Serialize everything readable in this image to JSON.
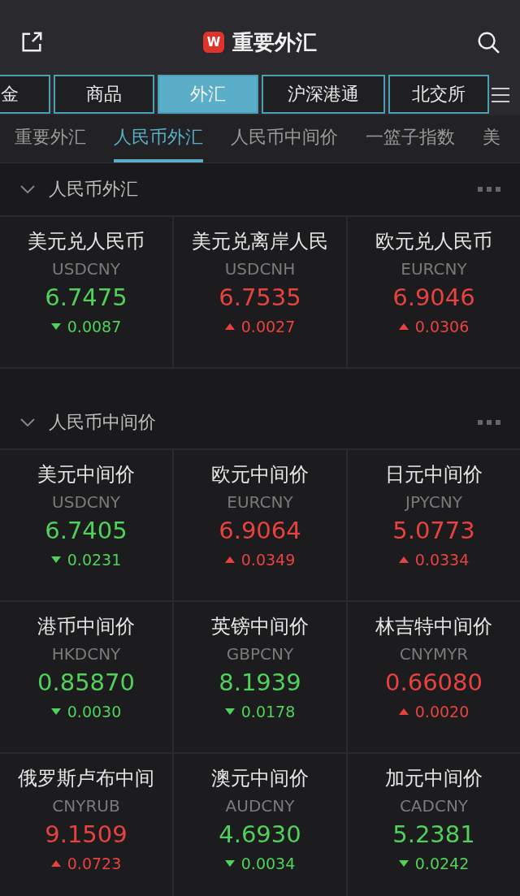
{
  "header": {
    "title": "重要外汇",
    "logo": "W"
  },
  "tabs": [
    {
      "label": "金",
      "selected": false
    },
    {
      "label": "商品",
      "selected": false
    },
    {
      "label": "外汇",
      "selected": true
    },
    {
      "label": "沪深港通",
      "selected": false
    },
    {
      "label": "北交所",
      "selected": false
    }
  ],
  "subtabs": [
    {
      "label": "重要外汇",
      "selected": false
    },
    {
      "label": "人民币外汇",
      "selected": true
    },
    {
      "label": "人民币中间价",
      "selected": false
    },
    {
      "label": "一篮子指数",
      "selected": false
    },
    {
      "label": "美",
      "selected": false
    }
  ],
  "sections": [
    {
      "title": "人民币外汇",
      "items": [
        {
          "name": "美元兑人民币",
          "code": "USDCNY",
          "price": "6.7475",
          "change": "0.0087",
          "rising": false
        },
        {
          "name": "美元兑离岸人民",
          "code": "USDCNH",
          "price": "6.7535",
          "change": "0.0027",
          "rising": true
        },
        {
          "name": "欧元兑人民币",
          "code": "EURCNY",
          "price": "6.9046",
          "change": "0.0306",
          "rising": true
        }
      ]
    },
    {
      "title": "人民币中间价",
      "items": [
        {
          "name": "美元中间价",
          "code": "USDCNY",
          "price": "6.7405",
          "change": "0.0231",
          "rising": false
        },
        {
          "name": "欧元中间价",
          "code": "EURCNY",
          "price": "6.9064",
          "change": "0.0349",
          "rising": true
        },
        {
          "name": "日元中间价",
          "code": "JPYCNY",
          "price": "5.0773",
          "change": "0.0334",
          "rising": true
        },
        {
          "name": "港币中间价",
          "code": "HKDCNY",
          "price": "0.85870",
          "change": "0.0030",
          "rising": false
        },
        {
          "name": "英镑中间价",
          "code": "GBPCNY",
          "price": "8.1939",
          "change": "0.0178",
          "rising": false
        },
        {
          "name": "林吉特中间价",
          "code": "CNYMYR",
          "price": "0.66080",
          "change": "0.0020",
          "rising": true
        },
        {
          "name": "俄罗斯卢布中间",
          "code": "CNYRUB",
          "price": "9.1509",
          "change": "0.0723",
          "rising": true
        },
        {
          "name": "澳元中间价",
          "code": "AUDCNY",
          "price": "4.6930",
          "change": "0.0034",
          "rising": false
        },
        {
          "name": "加元中间价",
          "code": "CADCNY",
          "price": "5.2381",
          "change": "0.0242",
          "rising": false
        }
      ]
    }
  ]
}
